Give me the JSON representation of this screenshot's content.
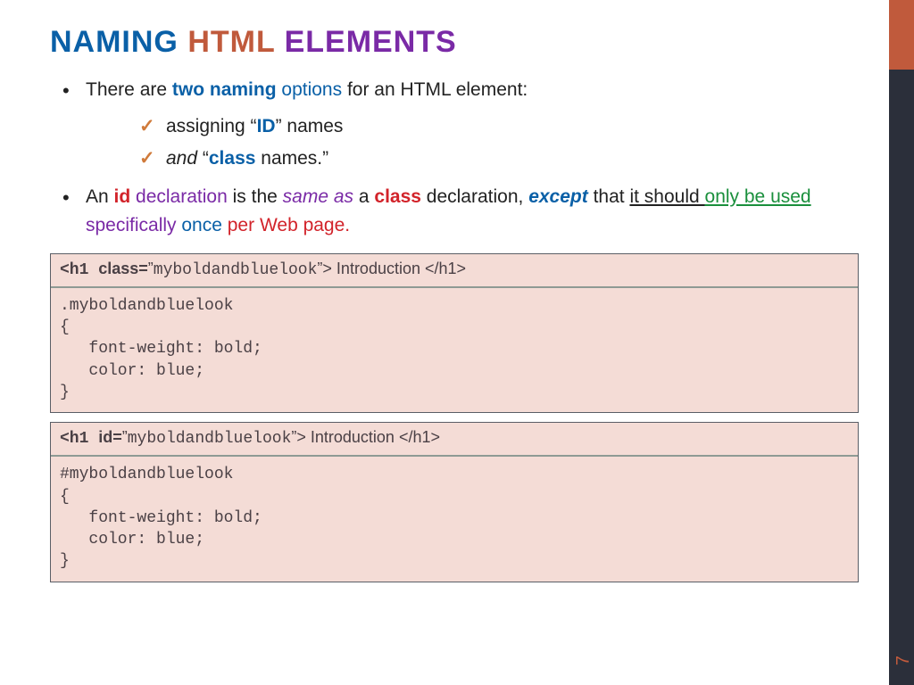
{
  "title": {
    "w1": "NAMING",
    "w2": "HTML",
    "w3": "ELEMENTS"
  },
  "line1": {
    "p1": "There are ",
    "p2": "two naming",
    "p3": " options",
    "p4": " for an HTML element:"
  },
  "sub": {
    "a1": "assigning “",
    "a2": "ID",
    "a3": "” names",
    "b1": "and ",
    "b2": "“",
    "b3": "class",
    "b4": " names.”"
  },
  "line2": {
    "p1": "An ",
    "p2": "id",
    "p3": " declaration",
    "p4": " is the ",
    "p5": "same as",
    "p6": " a ",
    "p7": "class",
    "p8": " declaration, ",
    "p9": "except",
    "p10": " that ",
    "p11": "it should ",
    "p12": "only be used ",
    "p13": "specifically ",
    "p14": "once",
    "p15": " per Web page."
  },
  "box1": {
    "head": {
      "t1": "<h1 ",
      "t2": "class=",
      "t3": "”",
      "t4": "myboldandbluelook",
      "t5": "”> Introduction </h1>"
    },
    "body": ".myboldandbluelook\n{\n   font-weight: bold;\n   color: blue;\n}"
  },
  "box2": {
    "head": {
      "t1": "<h1 ",
      "t2": "id=",
      "t3": "”",
      "t4": "myboldandbluelook",
      "t5": "”> Introduction </h1>"
    },
    "body": "#myboldandbluelook\n{\n   font-weight: bold;\n   color: blue;\n}"
  },
  "pagenum": "7"
}
